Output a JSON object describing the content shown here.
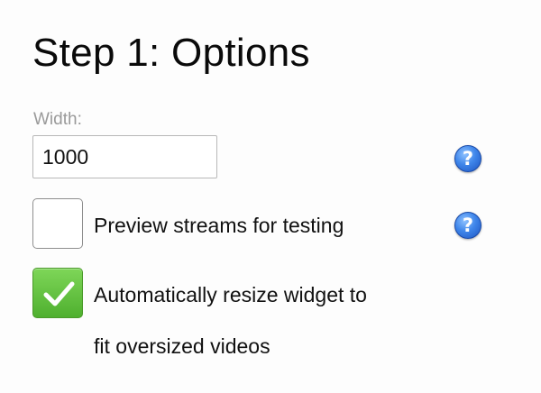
{
  "header": {
    "title": "Step 1: Options"
  },
  "width_field": {
    "label": "Width:",
    "value": "1000"
  },
  "help": {
    "glyph": "?",
    "icon": "help-question-icon",
    "color": "#3f86ea"
  },
  "options": {
    "preview_streams": {
      "label": "Preview streams for testing",
      "checked": false
    },
    "auto_resize": {
      "label_line1": "Automatically resize widget to",
      "label_line2": "fit oversized videos",
      "checked": true,
      "check_color": "#5cbf38"
    }
  }
}
